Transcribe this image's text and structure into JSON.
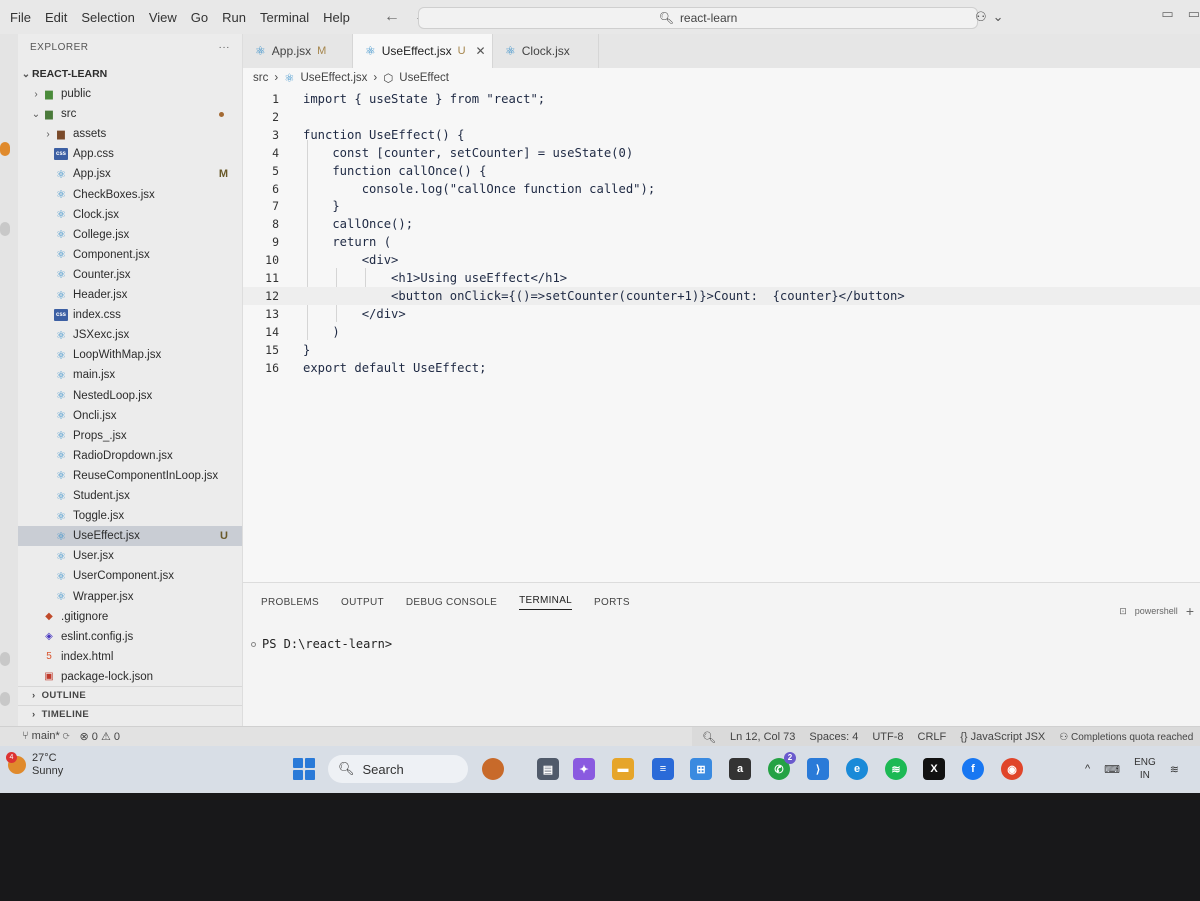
{
  "menu": [
    "File",
    "Edit",
    "Selection",
    "View",
    "Go",
    "Run",
    "Terminal",
    "Help"
  ],
  "command_center": {
    "text": "react-learn"
  },
  "explorer": {
    "title": "EXPLORER",
    "more": "···",
    "root": "REACT-LEARN",
    "items": [
      {
        "label": "public",
        "kind": "folder",
        "depth": 1,
        "twisty": "›"
      },
      {
        "label": "src",
        "kind": "folder",
        "depth": 1,
        "twisty": "⌄",
        "dot": true
      },
      {
        "label": "assets",
        "kind": "folder",
        "depth": 2,
        "twisty": "›"
      },
      {
        "label": "App.css",
        "kind": "css",
        "depth": 2
      },
      {
        "label": "App.jsx",
        "kind": "react",
        "depth": 2,
        "badge": "M"
      },
      {
        "label": "CheckBoxes.jsx",
        "kind": "react",
        "depth": 2
      },
      {
        "label": "Clock.jsx",
        "kind": "react",
        "depth": 2
      },
      {
        "label": "College.jsx",
        "kind": "react",
        "depth": 2
      },
      {
        "label": "Component.jsx",
        "kind": "react",
        "depth": 2
      },
      {
        "label": "Counter.jsx",
        "kind": "react",
        "depth": 2
      },
      {
        "label": "Header.jsx",
        "kind": "react",
        "depth": 2
      },
      {
        "label": "index.css",
        "kind": "css",
        "depth": 2
      },
      {
        "label": "JSXexc.jsx",
        "kind": "react",
        "depth": 2
      },
      {
        "label": "LoopWithMap.jsx",
        "kind": "react",
        "depth": 2
      },
      {
        "label": "main.jsx",
        "kind": "react",
        "depth": 2
      },
      {
        "label": "NestedLoop.jsx",
        "kind": "react",
        "depth": 2
      },
      {
        "label": "Oncli.jsx",
        "kind": "react",
        "depth": 2
      },
      {
        "label": "Props_.jsx",
        "kind": "react",
        "depth": 2
      },
      {
        "label": "RadioDropdown.jsx",
        "kind": "react",
        "depth": 2
      },
      {
        "label": "ReuseComponentInLoop.jsx",
        "kind": "react",
        "depth": 2
      },
      {
        "label": "Student.jsx",
        "kind": "react",
        "depth": 2
      },
      {
        "label": "Toggle.jsx",
        "kind": "react",
        "depth": 2
      },
      {
        "label": "UseEffect.jsx",
        "kind": "react",
        "depth": 2,
        "badge": "U",
        "selected": true
      },
      {
        "label": "User.jsx",
        "kind": "react",
        "depth": 2
      },
      {
        "label": "UserComponent.jsx",
        "kind": "react",
        "depth": 2
      },
      {
        "label": "Wrapper.jsx",
        "kind": "react",
        "depth": 2
      },
      {
        "label": ".gitignore",
        "kind": "git",
        "depth": 1
      },
      {
        "label": "eslint.config.js",
        "kind": "eslint",
        "depth": 1
      },
      {
        "label": "index.html",
        "kind": "html",
        "depth": 1
      },
      {
        "label": "package-lock.json",
        "kind": "json",
        "depth": 1
      }
    ],
    "outline": "OUTLINE",
    "timeline": "TIMELINE"
  },
  "tabs": [
    {
      "label": "App.jsx",
      "status": "M",
      "active": false
    },
    {
      "label": "UseEffect.jsx",
      "status": "U",
      "active": true,
      "close": "✕"
    },
    {
      "label": "Clock.jsx",
      "status": "",
      "active": false
    }
  ],
  "breadcrumb": {
    "folder": "src",
    "file": "UseEffect.jsx",
    "symbol": "UseEffect"
  },
  "code_lines": [
    {
      "n": "1",
      "text": "import { useState } from \"react\";"
    },
    {
      "n": "2",
      "text": ""
    },
    {
      "n": "3",
      "text": "function UseEffect() {"
    },
    {
      "n": "4",
      "text": "    const [counter, setCounter] = useState(0)"
    },
    {
      "n": "5",
      "text": "    function callOnce() {"
    },
    {
      "n": "6",
      "text": "        console.log(\"callOnce function called\");"
    },
    {
      "n": "7",
      "text": "    }"
    },
    {
      "n": "8",
      "text": "    callOnce();"
    },
    {
      "n": "9",
      "text": "    return ("
    },
    {
      "n": "10",
      "text": "        <div>"
    },
    {
      "n": "11",
      "text": "            <h1>Using useEffect</h1>"
    },
    {
      "n": "12",
      "text": "            <button onClick={()=>setCounter(counter+1)}>Count:  {counter}</button>"
    },
    {
      "n": "13",
      "text": "        </div>"
    },
    {
      "n": "14",
      "text": "    )"
    },
    {
      "n": "15",
      "text": "}"
    },
    {
      "n": "16",
      "text": "export default UseEffect;"
    }
  ],
  "panel": {
    "tabs": [
      "PROBLEMS",
      "OUTPUT",
      "DEBUG CONSOLE",
      "TERMINAL",
      "PORTS"
    ],
    "active_tab": "TERMINAL",
    "shell": "powershell",
    "add": "+",
    "prompt": "PS D:\\react-learn>"
  },
  "status": {
    "branch": "main*",
    "errors": "0",
    "warnings": "0",
    "cursor": "Ln 12, Col 73",
    "spaces": "Spaces: 4",
    "encoding": "UTF-8",
    "eol": "CRLF",
    "language": "JavaScript JSX",
    "copilot": "Completions quota reached"
  },
  "taskbar": {
    "temperature": "27°C",
    "weather": "Sunny",
    "weather_badge": "4",
    "search": "Search",
    "whatsapp_badge": "2",
    "lang_top": "ENG",
    "lang_bottom": "IN"
  },
  "colors": {
    "accent_blue": "#2e8bc9",
    "selection": "#c9cdd4",
    "modified": "#a4844a"
  }
}
